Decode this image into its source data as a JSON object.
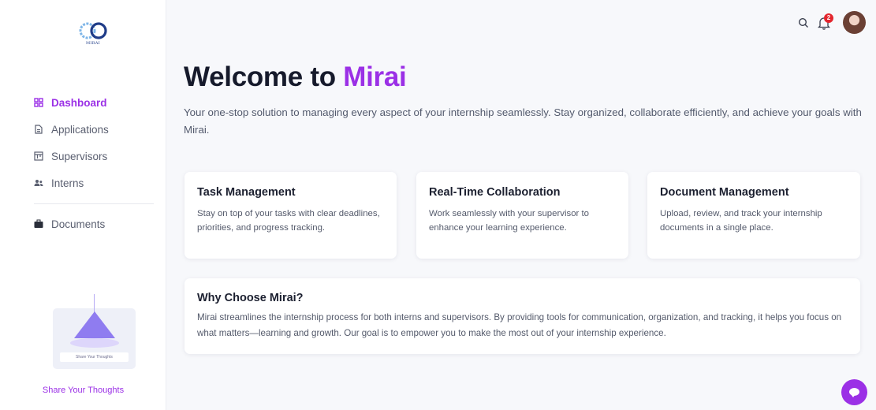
{
  "brand": {
    "logo_text": "MIRAI",
    "accent_color": "#9b30e6"
  },
  "sidebar": {
    "items": [
      {
        "label": "Dashboard",
        "icon": "grid-icon",
        "active": true
      },
      {
        "label": "Applications",
        "icon": "document-icon",
        "active": false
      },
      {
        "label": "Supervisors",
        "icon": "board-icon",
        "active": false
      },
      {
        "label": "Interns",
        "icon": "users-icon",
        "active": false
      },
      {
        "label": "Documents",
        "icon": "briefcase-icon",
        "active": false
      }
    ],
    "thoughts_card_label": "Share Your Thoughts",
    "thoughts_link": "Share Your Thoughts"
  },
  "topbar": {
    "search_icon": "search-icon",
    "bell_icon": "bell-icon",
    "notification_count": "2"
  },
  "hero": {
    "title_prefix": "Welcome to ",
    "title_accent": "Mirai",
    "subtitle": "Your one-stop solution to managing every aspect of your internship seamlessly. Stay organized, collaborate efficiently, and achieve your goals with Mirai."
  },
  "features": [
    {
      "title": "Task Management",
      "text": "Stay on top of your tasks with clear deadlines, priorities, and progress tracking."
    },
    {
      "title": "Real-Time Collaboration",
      "text": "Work seamlessly with your supervisor to enhance your learning experience."
    },
    {
      "title": "Document Management",
      "text": "Upload, review, and track your internship documents in a single place."
    }
  ],
  "why": {
    "title": "Why Choose Mirai?",
    "text": "Mirai streamlines the internship process for both interns and supervisors. By providing tools for communication, organization, and tracking, it helps you focus on what matters—learning and growth. Our goal is to empower you to make the most out of your internship experience."
  },
  "chat": {
    "icon": "chat-bubble-icon"
  }
}
